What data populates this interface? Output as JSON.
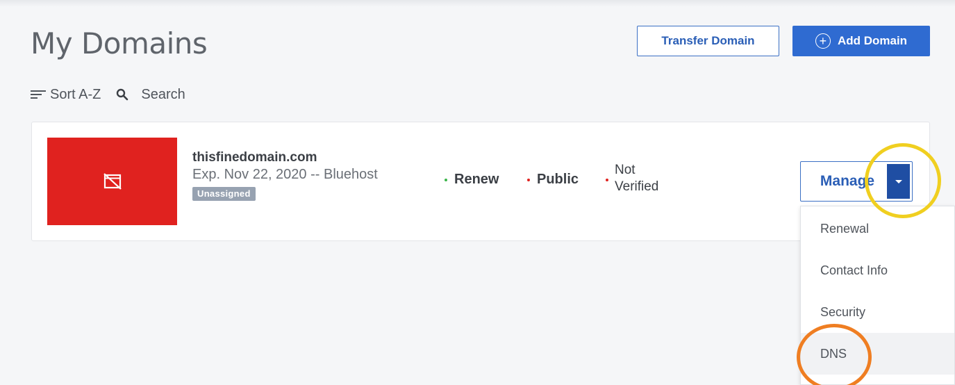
{
  "page": {
    "title": "My Domains",
    "transfer_label": "Transfer Domain",
    "add_label": "Add Domain",
    "sort_label": "Sort A-Z",
    "search_label": "Search"
  },
  "domain": {
    "name": "thisfinedomain.com",
    "expiry": "Exp. Nov 22, 2020 -- Bluehost",
    "badge": "Unassigned",
    "statuses": [
      {
        "label": "Renew",
        "color": "#3bb54a"
      },
      {
        "label": "Public",
        "color": "#e0221f"
      },
      {
        "label": "Not Verified",
        "color": "#e0221f"
      }
    ],
    "manage_label": "Manage"
  },
  "menu": {
    "items": [
      "Renewal",
      "Contact Info",
      "Security",
      "DNS"
    ],
    "active": "DNS"
  },
  "colors": {
    "primary": "#2f6bd1",
    "thumb": "#e0221f",
    "highlight_yellow": "#f0cf20",
    "highlight_orange": "#ef7e22"
  },
  "icons": {
    "add": "plus-circle-icon",
    "sort": "sort-lines-icon",
    "search": "magnifier-icon",
    "thumb": "no-image-icon",
    "dropdown": "caret-down-icon"
  }
}
